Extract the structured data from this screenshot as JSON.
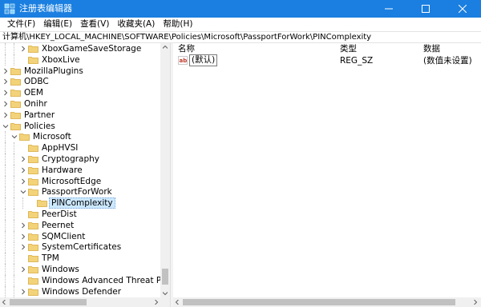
{
  "window": {
    "title": "注册表编辑器",
    "app_icon": "regedit-icon",
    "titlebar_color": "#1a7fe0",
    "controls": [
      "minimize-icon",
      "maximize-icon",
      "close-icon"
    ]
  },
  "menu": {
    "items": [
      "文件(F)",
      "编辑(E)",
      "查看(V)",
      "收藏夹(A)",
      "帮助(H)"
    ]
  },
  "address": {
    "path": "计算机\\HKEY_LOCAL_MACHINE\\SOFTWARE\\Policies\\Microsoft\\PassportForWork\\PINComplexity"
  },
  "tree": {
    "items": [
      {
        "label": "XboxGameSaveStorage",
        "expander": "collapsed"
      },
      {
        "label": "XboxLive",
        "expander": "none"
      },
      {
        "label": "MozillaPlugins",
        "expander": "collapsed"
      },
      {
        "label": "ODBC",
        "expander": "collapsed"
      },
      {
        "label": "OEM",
        "expander": "collapsed"
      },
      {
        "label": "Onihr",
        "expander": "collapsed"
      },
      {
        "label": "Partner",
        "expander": "collapsed"
      },
      {
        "label": "Policies",
        "expander": "expanded"
      },
      {
        "label": "Microsoft",
        "expander": "expanded"
      },
      {
        "label": "AppHVSI",
        "expander": "none"
      },
      {
        "label": "Cryptography",
        "expander": "collapsed"
      },
      {
        "label": "Hardware",
        "expander": "collapsed"
      },
      {
        "label": "MicrosoftEdge",
        "expander": "collapsed"
      },
      {
        "label": "PassportForWork",
        "expander": "expanded"
      },
      {
        "label": "PINComplexity",
        "expander": "none",
        "selected": true
      },
      {
        "label": "PeerDist",
        "expander": "none"
      },
      {
        "label": "Peernet",
        "expander": "collapsed"
      },
      {
        "label": "SQMClient",
        "expander": "collapsed"
      },
      {
        "label": "SystemCertificates",
        "expander": "collapsed"
      },
      {
        "label": "TPM",
        "expander": "none"
      },
      {
        "label": "Windows",
        "expander": "collapsed"
      },
      {
        "label": "Windows Advanced Threat Protection",
        "expander": "none"
      },
      {
        "label": "Windows Defender",
        "expander": "collapsed"
      }
    ]
  },
  "values": {
    "columns": {
      "name": "名称",
      "type": "类型",
      "data": "数据"
    },
    "rows": [
      {
        "icon": "string-value-icon",
        "name": "(默认)",
        "type": "REG_SZ",
        "data": "(数值未设置)"
      }
    ]
  },
  "colors": {
    "selection": "#cce8ff",
    "folder": "#f3d37a"
  }
}
